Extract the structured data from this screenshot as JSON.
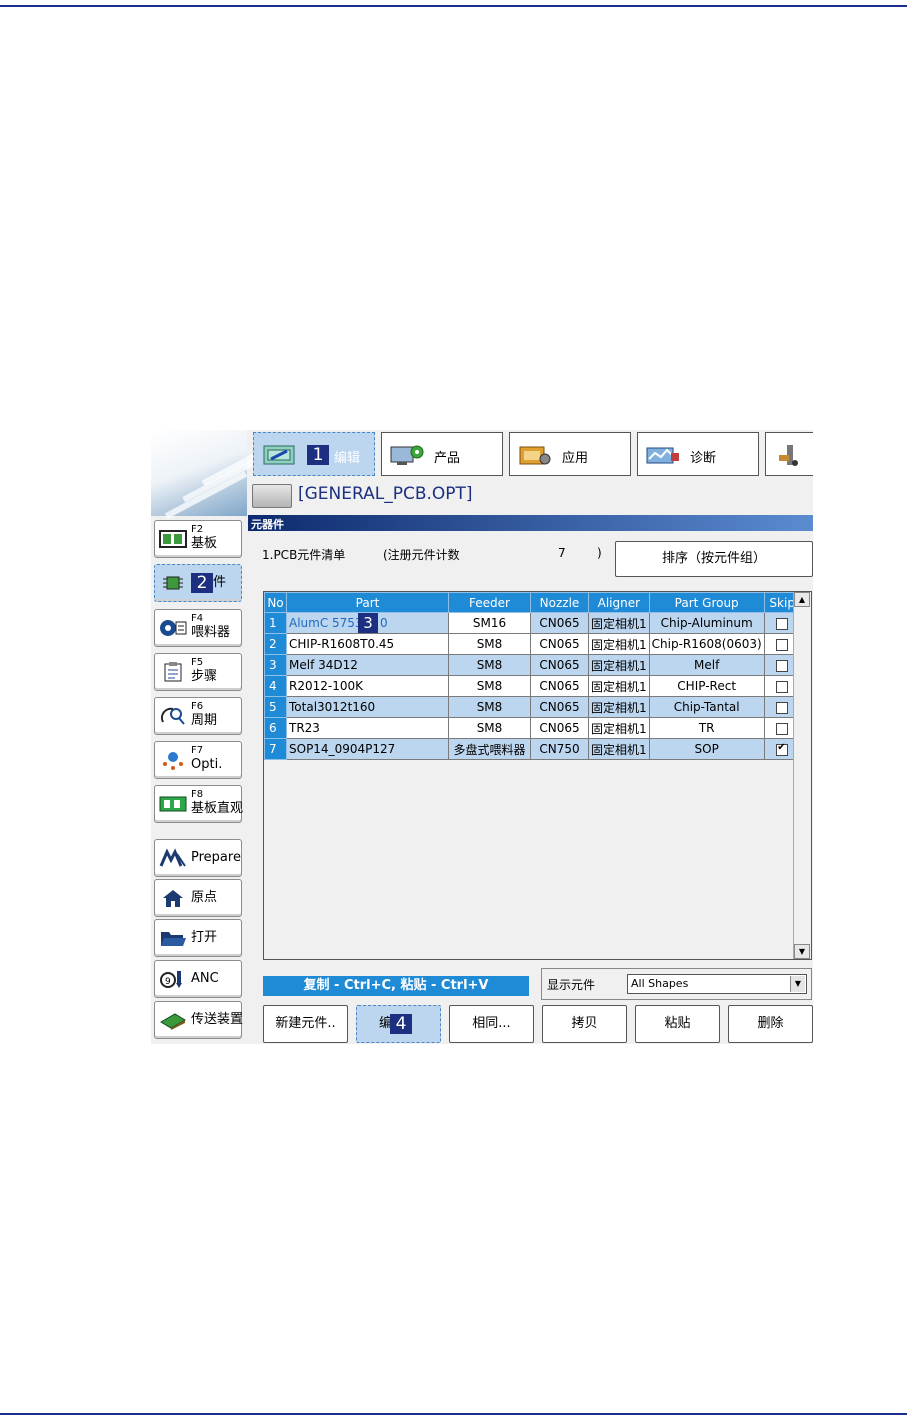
{
  "tabs": [
    {
      "label": "编辑",
      "badge": "1"
    },
    {
      "label": "产品"
    },
    {
      "label": "应用"
    },
    {
      "label": "诊断"
    }
  ],
  "path": "[GENERAL_PCB.OPT]",
  "panel_title": "元器件",
  "sidebar": [
    {
      "key": "F2",
      "label": "基板"
    },
    {
      "key": "",
      "label": "件",
      "badge": "2"
    },
    {
      "key": "F4",
      "label": "喂料器"
    },
    {
      "key": "F5",
      "label": "步骤"
    },
    {
      "key": "F6",
      "label": "周期"
    },
    {
      "key": "F7",
      "label": "Opti."
    },
    {
      "key": "F8",
      "label": "基板直观"
    },
    {
      "key": "",
      "label": "Prepare"
    },
    {
      "key": "",
      "label": "原点"
    },
    {
      "key": "",
      "label": "打开"
    },
    {
      "key": "",
      "label": "ANC"
    },
    {
      "key": "",
      "label": "传送装置"
    }
  ],
  "list_label": "1.PCB元件清单",
  "count_label": "(注册元件计数",
  "count_value": "7",
  "count_close": ")",
  "sort_button": "排序（按元件组）",
  "table": {
    "columns": [
      "No",
      "Part",
      "Feeder",
      "Nozzle",
      "Aligner",
      "Part Group",
      "Skip"
    ],
    "part_badge": "3",
    "rows": [
      {
        "no": "1",
        "part": "AlumC 5753",
        "part_tail": "0",
        "feeder": "SM16",
        "nozzle": "CN065",
        "aligner": "固定相机1",
        "group": "Chip-Aluminum",
        "skip": false
      },
      {
        "no": "2",
        "part": "CHIP-R1608T0.45",
        "feeder": "SM8",
        "nozzle": "CN065",
        "aligner": "固定相机1",
        "group": "Chip-R1608(0603)",
        "skip": false
      },
      {
        "no": "3",
        "part": "Melf 34D12",
        "feeder": "SM8",
        "nozzle": "CN065",
        "aligner": "固定相机1",
        "group": "Melf",
        "skip": false
      },
      {
        "no": "4",
        "part": "R2012-100K",
        "feeder": "SM8",
        "nozzle": "CN065",
        "aligner": "固定相机1",
        "group": "CHIP-Rect",
        "skip": false
      },
      {
        "no": "5",
        "part": "Total3012t160",
        "feeder": "SM8",
        "nozzle": "CN065",
        "aligner": "固定相机1",
        "group": "Chip-Tantal",
        "skip": false
      },
      {
        "no": "6",
        "part": "TR23",
        "feeder": "SM8",
        "nozzle": "CN065",
        "aligner": "固定相机1",
        "group": "TR",
        "skip": false
      },
      {
        "no": "7",
        "part": "SOP14_0904P127",
        "feeder": "多盘式喂料器",
        "nozzle": "CN750",
        "aligner": "固定相机1",
        "group": "SOP",
        "skip": true
      }
    ]
  },
  "hint": "复制 - Ctrl+C, 粘贴 - Ctrl+V",
  "show_label": "显示元件",
  "show_value": "All Shapes",
  "buttons": [
    {
      "label": "新建元件.."
    },
    {
      "label": "编",
      "badge": "4"
    },
    {
      "label": "相同..."
    },
    {
      "label": "拷贝"
    },
    {
      "label": "粘贴"
    },
    {
      "label": "删除"
    }
  ],
  "colors": {
    "accent": "#1f8ad6",
    "selected": "#bcd6ef",
    "badge": "#1c2f80",
    "rule": "#1a2f8a"
  }
}
